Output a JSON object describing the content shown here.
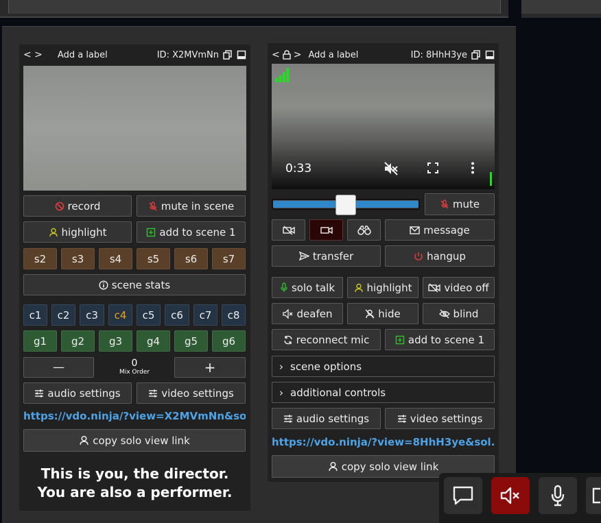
{
  "left": {
    "label": "Add a label",
    "id_text": "ID: X2MVmNn",
    "record": "record",
    "mute_scene": "mute in scene",
    "highlight": "highlight",
    "add_scene": "add to scene 1",
    "scenes": [
      "s2",
      "s3",
      "s4",
      "s5",
      "s6",
      "s7"
    ],
    "scene_stats": "scene stats",
    "channels": [
      "c1",
      "c2",
      "c3",
      "c4",
      "c5",
      "c6",
      "c7",
      "c8"
    ],
    "groups": [
      "g1",
      "g2",
      "g3",
      "g4",
      "g5",
      "g6"
    ],
    "minus": "—",
    "mix_value": "0",
    "mix_label": "Mix Order",
    "plus": "+",
    "audio_settings": "audio settings",
    "video_settings": "video settings",
    "link": "https://vdo.ninja/?view=X2MVmNn&so...",
    "copy_solo": "copy solo view link",
    "director_line1": "This is you, the director.",
    "director_line2": "You are also a performer."
  },
  "right": {
    "label": "Add a label",
    "id_text": "ID: 8HhH3ye",
    "time": "0:33",
    "volume_level": 0.5,
    "mute": "mute",
    "message": "message",
    "transfer": "transfer",
    "hangup": "hangup",
    "solo_talk": "solo talk",
    "highlight": "highlight",
    "video_off": "video off",
    "deafen": "deafen",
    "hide": "hide",
    "blind": "blind",
    "reconnect_mic": "reconnect mic",
    "add_scene": "add to scene 1",
    "scene_options": "scene options",
    "additional_controls": "additional controls",
    "audio_settings": "audio settings",
    "video_settings": "video settings",
    "link": "https://vdo.ninja/?view=8HhH3ye&sol...",
    "copy_solo": "copy solo view link"
  },
  "colors": {
    "accent_link": "#4ea3e6",
    "record_red": "#e03c3c",
    "highlight_yellow": "#c8c81e",
    "add_green": "#2ec02e",
    "mic_muted_bg": "#8b0a0a",
    "signal_green": "#22dd22"
  }
}
